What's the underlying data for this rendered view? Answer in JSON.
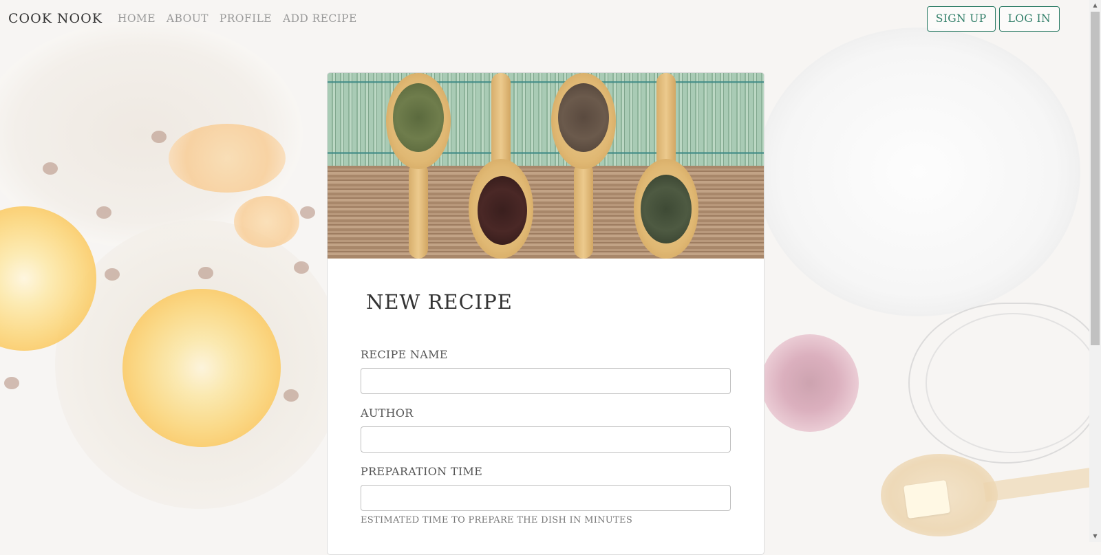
{
  "nav": {
    "brand": "COOK NOOK",
    "links": [
      {
        "label": "HOME"
      },
      {
        "label": "ABOUT"
      },
      {
        "label": "PROFILE"
      },
      {
        "label": "ADD RECIPE"
      }
    ],
    "signup_label": "SIGN UP",
    "login_label": "LOG IN"
  },
  "form": {
    "title": "NEW RECIPE",
    "fields": [
      {
        "label": "RECIPE NAME",
        "value": ""
      },
      {
        "label": "AUTHOR",
        "value": ""
      },
      {
        "label": "PREPARATION TIME",
        "value": "",
        "help": "ESTIMATED TIME TO PREPARE THE DISH IN MINUTES"
      }
    ]
  },
  "colors": {
    "accent": "#2e7d67",
    "nav_text": "#9a9a9a"
  },
  "icons": {
    "scroll_up": "scroll-up-arrow-icon",
    "scroll_down": "scroll-down-arrow-icon"
  }
}
